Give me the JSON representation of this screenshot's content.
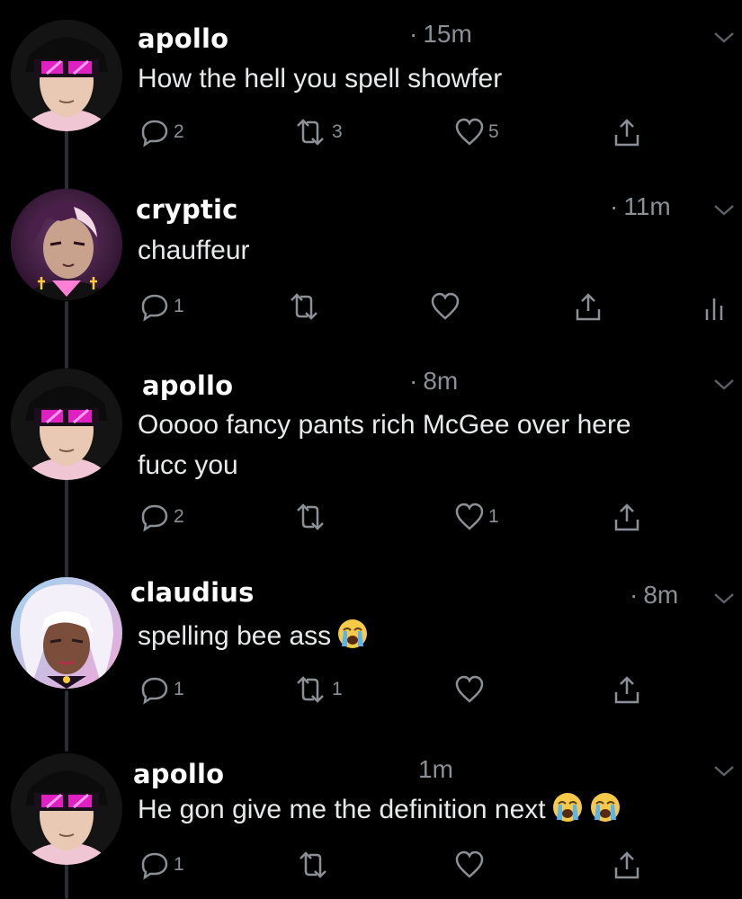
{
  "tweets": [
    {
      "name": "apollo",
      "time": "15m",
      "text": "How the hell you spell showfer",
      "text2": "",
      "replies": "2",
      "retweets": "3",
      "likes": "5"
    },
    {
      "name": "cryptic",
      "time": "11m",
      "text": "chauffeur",
      "text2": "",
      "replies": "1",
      "retweets": "",
      "likes": ""
    },
    {
      "name": "apollo",
      "time": "8m",
      "text": "Ooooo fancy pants rich McGee over here",
      "text2": "fucc you",
      "replies": "2",
      "retweets": "",
      "likes": "1"
    },
    {
      "name": "claudius",
      "time": "8m",
      "text": "spelling bee ass",
      "text2": "",
      "replies": "1",
      "retweets": "1",
      "likes": ""
    },
    {
      "name": "apollo",
      "time": "1m",
      "text": "He gon give me the definition next",
      "text2": "",
      "replies": "1",
      "retweets": "",
      "likes": ""
    }
  ],
  "icons": {
    "reply": "reply-icon",
    "retweet": "retweet-icon",
    "like": "heart-icon",
    "share": "share-icon",
    "analytics": "analytics-icon",
    "more": "chevron-down-icon",
    "emoji": "loudly-crying-face-emoji"
  },
  "colors": {
    "background": "#000000",
    "text": "#e7e9ea",
    "muted": "#8b9096",
    "thread_line": "#2a2d31"
  }
}
